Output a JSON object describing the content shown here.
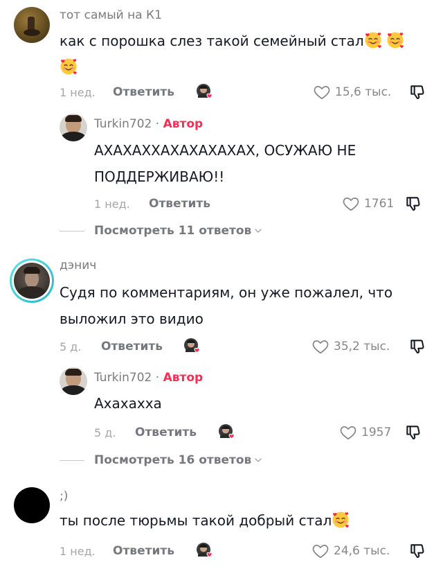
{
  "comments": [
    {
      "username": "тот самый на К1",
      "text": "как с порошка слез такой семейный стал",
      "time": "1 нед.",
      "reply_label": "Ответить",
      "likes": "15,6 тыс.",
      "emoji_count": 3
    },
    {
      "username": "Turkin702",
      "author_badge": "Автор",
      "text_line1": "АХАХАХХАХАХАХАХАХ, ОСУЖАЮ НЕ",
      "text_line2": "ПОДДЕРЖИВАЮ!!",
      "time": "1 нед.",
      "reply_label": "Ответить",
      "likes": "1761",
      "view_replies": "Посмотреть 11 ответов"
    },
    {
      "username": "дэнич",
      "text_line1": "Судя по комментариям, он уже пожалел, что",
      "text_line2": "выложил это видио",
      "time": "5 д.",
      "reply_label": "Ответить",
      "likes": "35,2 тыс."
    },
    {
      "username": "Turkin702",
      "author_badge": "Автор",
      "text": "Ахахахха",
      "time": "5 д.",
      "reply_label": "Ответить",
      "likes": "1957",
      "view_replies": "Посмотреть 16 ответов"
    },
    {
      "username": ";)",
      "text": "ты после тюрьмы такой добрый стал",
      "time": "1 нед.",
      "reply_label": "Ответить",
      "likes": "24,6 тыс."
    }
  ],
  "separator": "·",
  "icons": [
    "heart-outline-icon",
    "dislike-icon",
    "chevron-down-icon",
    "smiling-face-with-hearts-emoji",
    "creator-liked-icon"
  ],
  "colors": {
    "author": "#fe2c55",
    "text": "#161823",
    "meta": "#a4a5a8",
    "reply": "#77787d",
    "heart": "#fe2c55"
  }
}
